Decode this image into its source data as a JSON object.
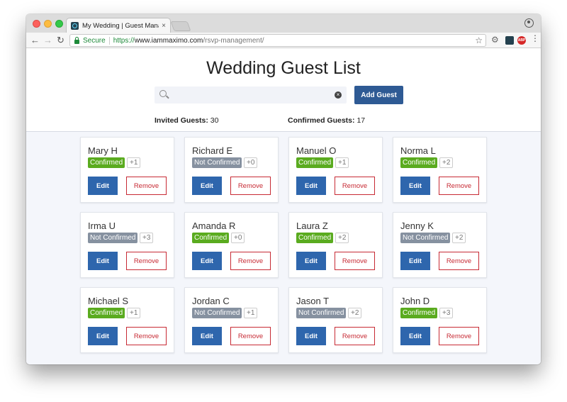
{
  "browser": {
    "tab_title": "My Wedding | Guest Management",
    "tab_close": "×",
    "secure_label": "Secure",
    "url_scheme": "https://",
    "url_host": "www.iammaximo.com",
    "url_path": "/rsvp-management/",
    "abp_label": "ABP"
  },
  "page": {
    "title": "Wedding Guest List",
    "search": {
      "value": "",
      "placeholder": ""
    },
    "add_guest_label": "Add Guest",
    "invited_label": "Invited Guests:",
    "invited_count": "30",
    "confirmed_label": "Confirmed Guests:",
    "confirmed_count": "17"
  },
  "buttons": {
    "edit_label": "Edit",
    "remove_label": "Remove"
  },
  "colors": {
    "confirmed": "#5aab1f",
    "not_confirmed": "#8691a0",
    "primary": "#2e66ad",
    "danger": "#c72a34"
  },
  "guests": [
    {
      "name": "Mary H",
      "status": "Confirmed",
      "confirmed": true,
      "plus": "+1"
    },
    {
      "name": "Richard E",
      "status": "Not Confirmed",
      "confirmed": false,
      "plus": "+0"
    },
    {
      "name": "Manuel O",
      "status": "Confirmed",
      "confirmed": true,
      "plus": "+1"
    },
    {
      "name": "Norma L",
      "status": "Confirmed",
      "confirmed": true,
      "plus": "+2"
    },
    {
      "name": "Irma U",
      "status": "Not Confirmed",
      "confirmed": false,
      "plus": "+3"
    },
    {
      "name": "Amanda R",
      "status": "Confirmed",
      "confirmed": true,
      "plus": "+0"
    },
    {
      "name": "Laura Z",
      "status": "Confirmed",
      "confirmed": true,
      "plus": "+2"
    },
    {
      "name": "Jenny K",
      "status": "Not Confirmed",
      "confirmed": false,
      "plus": "+2"
    },
    {
      "name": "Michael S",
      "status": "Confirmed",
      "confirmed": true,
      "plus": "+1"
    },
    {
      "name": "Jordan C",
      "status": "Not Confirmed",
      "confirmed": false,
      "plus": "+1"
    },
    {
      "name": "Jason T",
      "status": "Not Confirmed",
      "confirmed": false,
      "plus": "+2"
    },
    {
      "name": "John D",
      "status": "Confirmed",
      "confirmed": true,
      "plus": "+3"
    }
  ]
}
